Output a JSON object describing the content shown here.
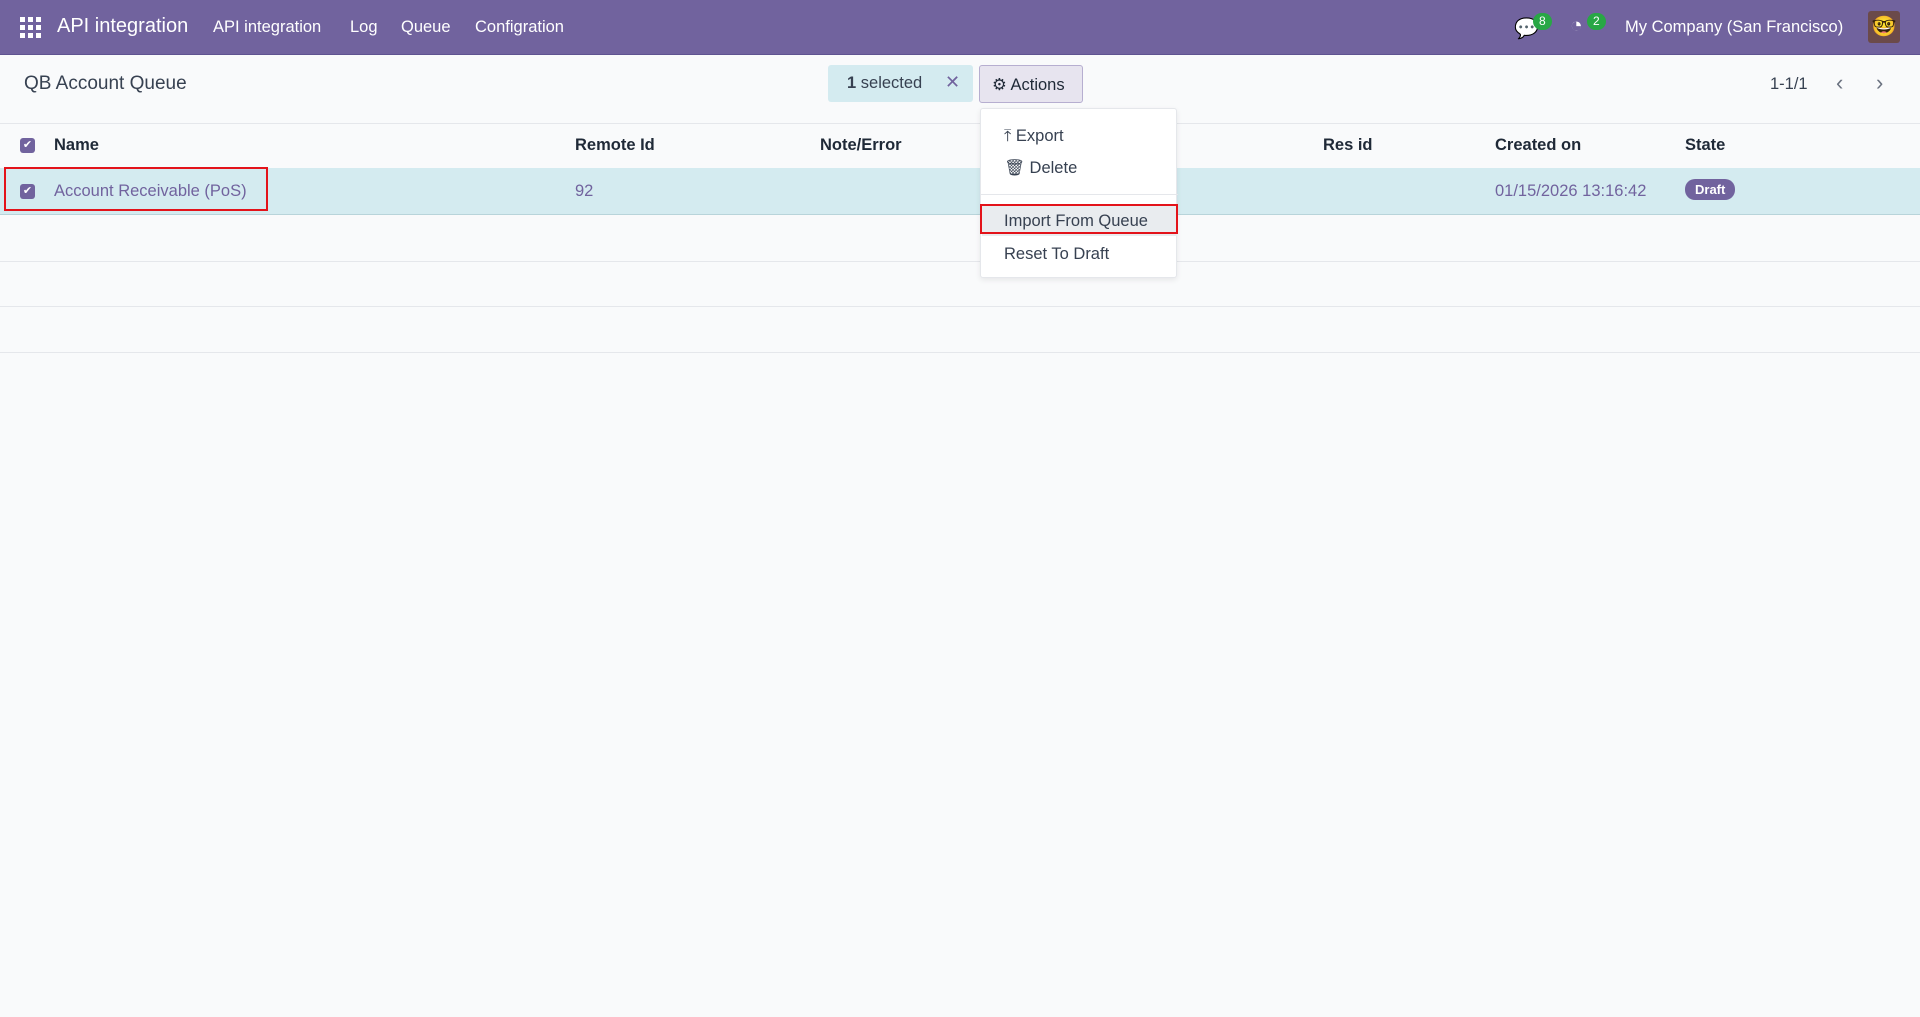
{
  "navbar": {
    "app_title": "API integration",
    "menu": [
      "API integration",
      "Log",
      "Queue",
      "Configration"
    ],
    "messages_count": "8",
    "activities_count": "2",
    "company": "My Company (San Francisco)"
  },
  "control": {
    "title": "QB Account Queue",
    "selected_count": "1",
    "selected_label": "selected",
    "actions_label": "Actions",
    "pager": "1-1/1"
  },
  "table": {
    "columns": [
      "Name",
      "Remote Id",
      "Note/Error",
      "Res id",
      "Created on",
      "State"
    ],
    "rows": [
      {
        "name": "Account Receivable (PoS)",
        "remote_id": "92",
        "note": "",
        "res_id": "",
        "created_on": "01/15/2026 13:16:42",
        "state": "Draft"
      }
    ]
  },
  "actions_menu": {
    "items": [
      "Export",
      "Delete",
      "Import From Queue",
      "Reset To Draft"
    ]
  },
  "colors": {
    "brand": "#71639e",
    "selected_row": "#d4ebf0",
    "badge": "#28a745",
    "highlight": "#e3131a"
  }
}
